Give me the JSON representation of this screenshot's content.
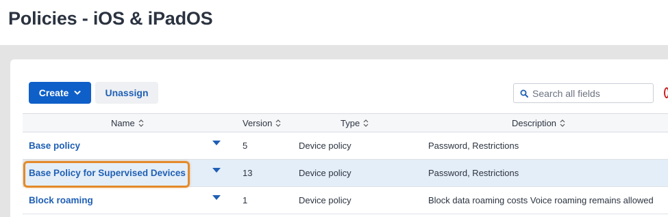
{
  "page": {
    "title": "Policies - iOS & iPadOS"
  },
  "toolbar": {
    "create_label": "Create",
    "unassign_label": "Unassign",
    "search_placeholder": "Search all fields"
  },
  "table": {
    "columns": [
      "Name",
      "Version",
      "Type",
      "Description"
    ],
    "rows": [
      {
        "name": "Base policy",
        "version": "5",
        "type": "Device policy",
        "description": "Password, Restrictions"
      },
      {
        "name": "Base Policy for Supervised Devices",
        "version": "13",
        "type": "Device policy",
        "description": "Password, Restrictions"
      },
      {
        "name": "Block roaming",
        "version": "1",
        "type": "Device policy",
        "description": "Block data roaming costs Voice roaming remains allowed"
      }
    ],
    "selected_row": 1
  },
  "colors": {
    "primary": "#0f5fc9",
    "link": "#1f5fb4",
    "highlight": "#e48a2a",
    "selected_row": "#e4eef8"
  },
  "icons": [
    "chevron-down-icon",
    "search-icon",
    "sort-icon",
    "caret-down-icon"
  ]
}
